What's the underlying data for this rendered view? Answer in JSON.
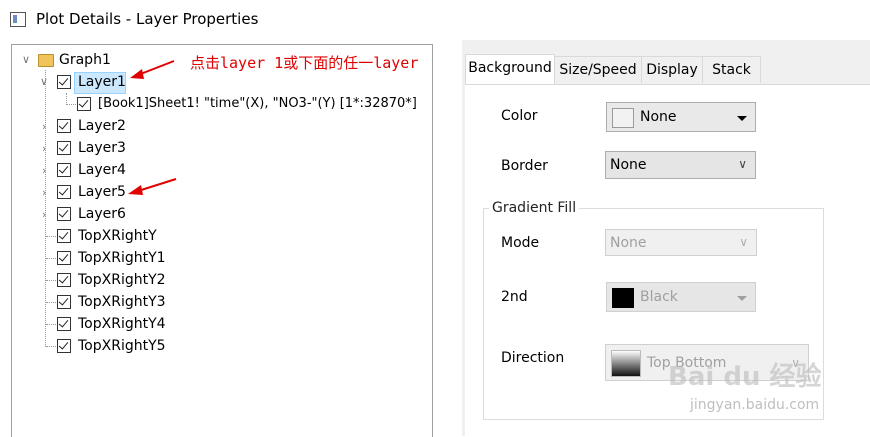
{
  "window": {
    "title": "Plot Details - Layer Properties"
  },
  "tree": {
    "root": "Graph1",
    "nodes": [
      {
        "label": "Layer1",
        "expanded": true,
        "selected": true
      },
      {
        "label": "[Book1]Sheet1! \"time\"(X), \"NO3-\"(Y) [1*:32870*]"
      },
      {
        "label": "Layer2"
      },
      {
        "label": "Layer3"
      },
      {
        "label": "Layer4"
      },
      {
        "label": "Layer5"
      },
      {
        "label": "Layer6"
      },
      {
        "label": "TopXRightY"
      },
      {
        "label": "TopXRightY1"
      },
      {
        "label": "TopXRightY2"
      },
      {
        "label": "TopXRightY3"
      },
      {
        "label": "TopXRightY4"
      },
      {
        "label": "TopXRightY5"
      }
    ]
  },
  "annotation": {
    "text": "点击layer 1或下面的任一layer",
    "color": "#e00000"
  },
  "tabs": [
    "Background",
    "Size/Speed",
    "Display",
    "Stack"
  ],
  "active_tab": "Background",
  "fields": {
    "color_label": "Color",
    "color_value": "None",
    "border_label": "Border",
    "border_value": "None",
    "gradient_group": "Gradient Fill",
    "mode_label": "Mode",
    "mode_value": "None",
    "second_label": "2nd",
    "second_value": "Black",
    "direction_label": "Direction",
    "direction_value": "Top Bottom"
  },
  "watermark": {
    "brand": "Bai du 经验",
    "url": "jingyan.baidu.com"
  }
}
